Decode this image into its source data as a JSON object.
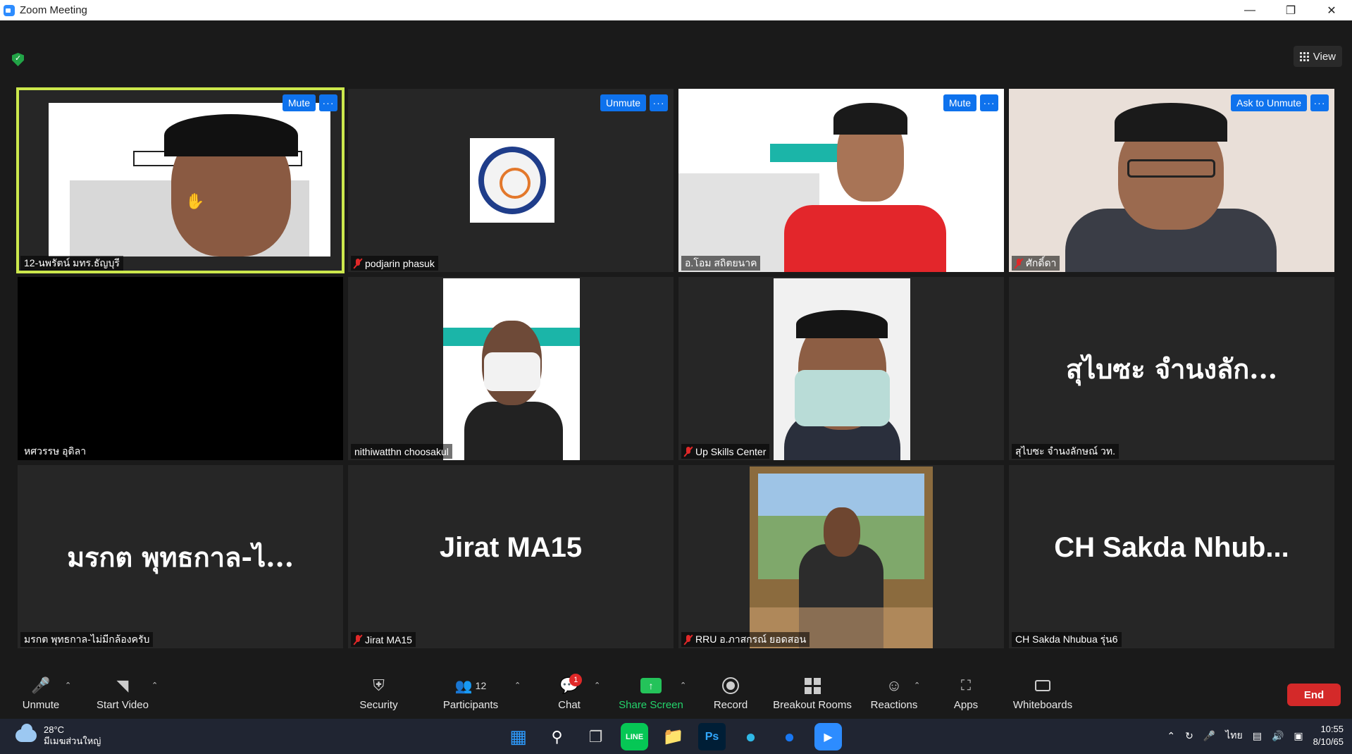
{
  "window": {
    "title": "Zoom Meeting"
  },
  "top": {
    "view_label": "View"
  },
  "tiles": [
    {
      "name": "12-นพรัตน์ มทร.ธัญบุรี",
      "btn": "Mute",
      "more": "···"
    },
    {
      "name": "podjarin phasuk",
      "btn": "Unmute",
      "more": "···"
    },
    {
      "name": "อ.โอม สถิตยนาค",
      "btn": "Mute",
      "more": "···"
    },
    {
      "name": "ศักดิ์ดา",
      "btn": "Ask to Unmute",
      "more": "···"
    },
    {
      "name": "หศวรรษ อุดิลา"
    },
    {
      "name": "nithiwatthn choosakul"
    },
    {
      "name": "Up Skills Center"
    },
    {
      "name": "สุไบซะ จำนงลักษณ์ วท.",
      "big": "สุไบซะ  จำนงลัก..."
    },
    {
      "name": "มรกต พุทธกาล-ไม่มีกล้องครับ",
      "big": "มรกต พุทธกาล-ไ..."
    },
    {
      "name": "Jirat MA15",
      "big": "Jirat MA15"
    },
    {
      "name": "RRU อ.ภาสกรณ์ ยอดสอน"
    },
    {
      "name": "CH Sakda Nhubua รุ่น6",
      "big": "CH Sakda Nhub..."
    }
  ],
  "toolbar": {
    "unmute": "Unmute",
    "start_video": "Start Video",
    "security": "Security",
    "participants": "Participants",
    "participants_count": "12",
    "chat": "Chat",
    "chat_badge": "1",
    "share_screen": "Share Screen",
    "record": "Record",
    "breakout_rooms": "Breakout Rooms",
    "reactions": "Reactions",
    "apps": "Apps",
    "whiteboards": "Whiteboards",
    "end": "End"
  },
  "taskbar": {
    "temperature": "28°C",
    "weather_desc": "มีเมฆส่วนใหญ่",
    "language": "ไทย",
    "time": "10:55",
    "date": "8/10/65"
  },
  "colors": {
    "accent": "#0e72ed",
    "active_speaker": "#cce84c",
    "share_green": "#24d36b",
    "end_red": "#d42929"
  }
}
